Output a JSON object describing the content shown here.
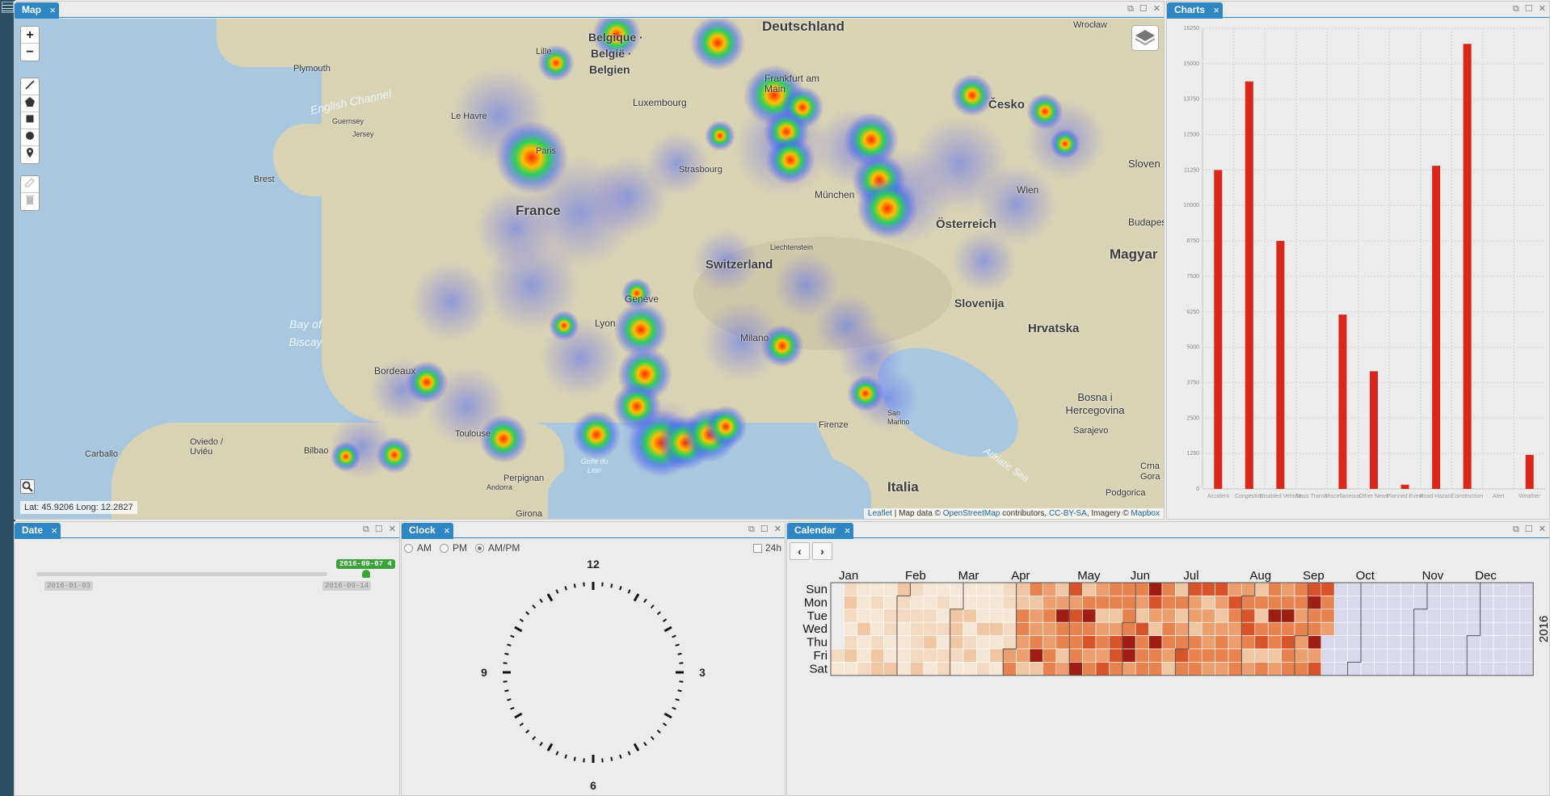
{
  "map_panel": {
    "tab_label": "Map",
    "coords_text": "Lat: 45.9206 Long: 12.2827",
    "attribution": {
      "leaflet": "Leaflet",
      "sep": " | Map data © ",
      "osm": "OpenStreetMap",
      "contrib": " contributors, ",
      "license": "CC-BY-SA",
      "imagery": ", Imagery © ",
      "mapbox": "Mapbox"
    },
    "zoom_in": "+",
    "zoom_out": "−",
    "place_labels": {
      "deutschland": "Deutschland",
      "wroclaw": "Wrocław",
      "belgique": "België ·",
      "belgique2": "Belgique ·",
      "belgien": "Belgien",
      "lille": "Lille",
      "plymouth": "Plymouth",
      "english_channel": "English Channel",
      "le_havre": "Le Havre",
      "guernsey": "Guernsey",
      "jersey": "Jersey",
      "paris": "Paris",
      "luxembourg": "Luxembourg",
      "frankfurt": "Frankfurt am Main",
      "cesko": "Česko",
      "brest": "Brest",
      "strasbourg": "Strasbourg",
      "munchen": "München",
      "wien": "Wien",
      "france": "France",
      "osterreich": "Österreich",
      "liechtenstein": "Liechtenstein",
      "switzerland": "Switzerland",
      "budapest": "Budapes",
      "magyar": "Magyar",
      "slovensko": "Sloven",
      "bay_biscay": "Bay of Biscay",
      "geneve": "Genève",
      "lyon": "Lyon",
      "slovenija": "Slovenija",
      "hrvatska": "Hrvatska",
      "milano": "Milano",
      "bordeaux": "Bordeaux",
      "san_marino": "San Marino",
      "bosna": "Bosna i Hercegovina",
      "sarajevo": "Sarajevo",
      "toulouse": "Toulouse",
      "firenze": "Firenze",
      "adriatic": "Adriatic Sea",
      "oviedo": "Oviedo / Uviéu",
      "carballo": "Carballo",
      "bilbao": "Bilbao",
      "golfe": "Golfe du Lion",
      "perpignan": "Perpignan",
      "andorra": "Andorra",
      "italia": "Italia",
      "crna": "Crna Gora",
      "podgorica": "Podgorica",
      "girona": "Girona"
    }
  },
  "charts_panel": {
    "tab_label": "Charts",
    "chart_data": {
      "type": "bar",
      "categories": [
        "Accident",
        "Congestion",
        "Disabled Vehicle",
        "Mass Transit",
        "Miscellaneous",
        "Other News",
        "Planned Event",
        "Road Hazard",
        "Construction",
        "Alert",
        "Weather"
      ],
      "values": [
        11250,
        14375,
        8750,
        0,
        6150,
        4150,
        150,
        11400,
        15700,
        0,
        1200
      ],
      "yticks": [
        0,
        1250,
        2500,
        3750,
        5000,
        6250,
        7500,
        8750,
        10000,
        11250,
        12500,
        13750,
        15000,
        16250
      ],
      "ylim": [
        0,
        16250
      ],
      "bar_color": "#d9271c"
    }
  },
  "date_panel": {
    "tab_label": "Date",
    "current_flag": "2016-09-07 4",
    "start_label": "2016-01-03",
    "end_label": "2016-09-14"
  },
  "clock_panel": {
    "tab_label": "Clock",
    "am": "AM",
    "pm": "PM",
    "ampm": "AM/PM",
    "h24": "24h",
    "numbers": {
      "n12": "12",
      "n3": "3",
      "n6": "6",
      "n9": "9"
    }
  },
  "calendar_panel": {
    "tab_label": "Calendar",
    "prev": "‹",
    "next": "›",
    "year": "2016",
    "months": [
      "Jan",
      "Feb",
      "Mar",
      "Apr",
      "May",
      "Jun",
      "Jul",
      "Aug",
      "Sep",
      "Oct",
      "Nov",
      "Dec"
    ],
    "days": [
      "Sun",
      "Mon",
      "Tue",
      "Wed",
      "Thu",
      "Fri",
      "Sat"
    ]
  }
}
